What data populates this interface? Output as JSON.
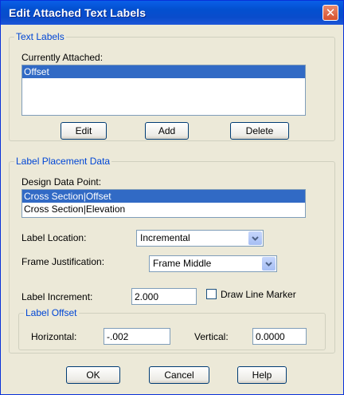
{
  "window": {
    "title": "Edit Attached Text Labels"
  },
  "text_labels": {
    "legend": "Text Labels",
    "currently_attached_label": "Currently Attached:",
    "items": [
      {
        "label": "Offset",
        "selected": true
      }
    ],
    "buttons": {
      "edit": "Edit",
      "add": "Add",
      "delete": "Delete"
    }
  },
  "placement": {
    "legend": "Label Placement Data",
    "design_point_label": "Design Data Point:",
    "design_points": [
      {
        "label": "Cross Section|Offset",
        "selected": true
      },
      {
        "label": "Cross Section|Elevation",
        "selected": false
      }
    ],
    "label_location": {
      "label": "Label Location:",
      "value": "Incremental"
    },
    "frame_justification": {
      "label": "Frame Justification:",
      "value": "Frame Middle"
    },
    "label_increment": {
      "label": "Label Increment:",
      "value": "2.000"
    },
    "draw_line_marker": {
      "label": "Draw Line Marker",
      "checked": false
    },
    "offset": {
      "legend": "Label Offset",
      "horizontal": {
        "label": "Horizontal:",
        "value": "-.002"
      },
      "vertical": {
        "label": "Vertical:",
        "value": "0.0000"
      }
    }
  },
  "footer": {
    "ok": "OK",
    "cancel": "Cancel",
    "help": "Help"
  }
}
